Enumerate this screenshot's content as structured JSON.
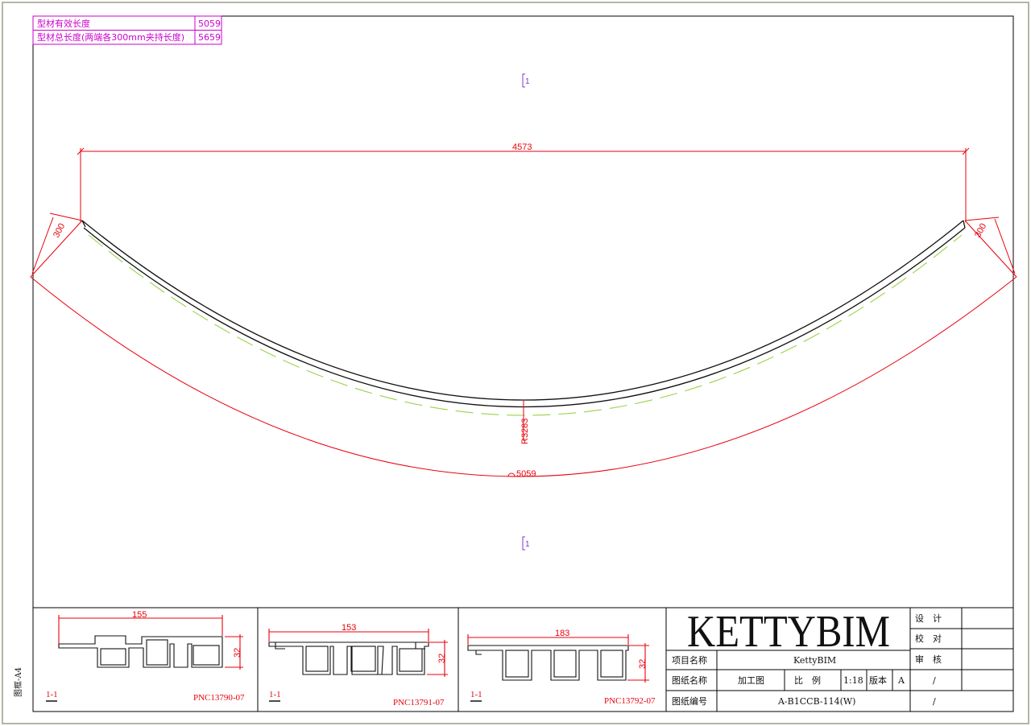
{
  "top_table": {
    "rows": [
      {
        "label": "型材有效长度",
        "value": "5059"
      },
      {
        "label": "型材总长度(两端各300mm夹持长度)",
        "value": "5659"
      }
    ]
  },
  "main_view": {
    "section_mark": "1",
    "dim_chord": "4573",
    "dim_clamp_left": "300",
    "dim_clamp_right": "300",
    "dim_radius": "R3283",
    "dim_arc": "5059"
  },
  "profiles": [
    {
      "width": "155",
      "height": "32",
      "section": "1-1",
      "code": "PNC13790-07"
    },
    {
      "width": "153",
      "height": "32",
      "section": "1-1",
      "code": "PNC13791-07"
    },
    {
      "width": "183",
      "height": "32",
      "section": "1-1",
      "code": "PNC13792-07"
    }
  ],
  "title_block": {
    "logo": "KETTYBIM",
    "project_label": "项目名称",
    "project_value": "KettyBIM",
    "drawing_label": "图纸名称",
    "drawing_value": "加工图",
    "scale_label": "比　例",
    "scale_value": "1:18",
    "version_label": "版本",
    "version_value": "A",
    "number_label": "图纸编号",
    "number_value": "A-B1CCB-114(W)",
    "design_label": "设　计",
    "check_label": "校　对",
    "review_label": "审　核",
    "slash1": "/",
    "slash2": "/"
  },
  "frame_label": "图框-A4",
  "colors": {
    "dimension": "#e8000b",
    "table_text": "#cc00cc",
    "profile_arc": "#111111",
    "offset_dash": "#9ad24a",
    "section_mark": "#7a3ad6"
  }
}
